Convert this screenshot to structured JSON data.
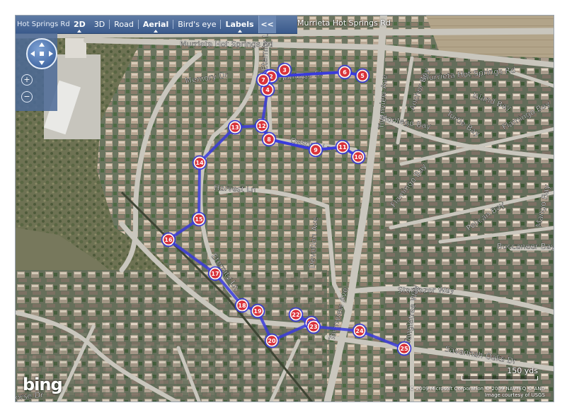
{
  "toolbar": {
    "search_text": "Hot Springs Rd",
    "items": [
      {
        "label": "2D",
        "bold": true,
        "selected": true
      },
      {
        "label": "3D",
        "bold": false,
        "selected": false
      },
      {
        "label": "Road",
        "bold": false,
        "selected": false
      },
      {
        "label": "Aerial",
        "bold": true,
        "selected": true
      },
      {
        "label": "Bird's eye",
        "bold": false,
        "selected": false
      },
      {
        "label": "Labels",
        "bold": true,
        "selected": true
      }
    ],
    "collapse_label": "<<",
    "overflow_text": "Murrieta Hot Springs Rd"
  },
  "controls": {
    "pan_icon": "compass-pan-icon",
    "zoom_in": "+",
    "zoom_out": "−"
  },
  "streets": [
    {
      "id": "murrieta-top-left",
      "text": "Murrieta Hot Springs Rd"
    },
    {
      "id": "murrieta-right",
      "text": "Murrieta Hot Springs Rd"
    },
    {
      "id": "memory",
      "text": "Memory Dr"
    },
    {
      "id": "eternity-top",
      "text": "Eternity Ln"
    },
    {
      "id": "heritage",
      "text": "Heritage St"
    },
    {
      "id": "townview-top",
      "text": "Townview Ave"
    },
    {
      "id": "anchor",
      "text": "Anchor Bay"
    },
    {
      "id": "island",
      "text": "Island Bay"
    },
    {
      "id": "turtle",
      "text": "Turtle Bay"
    },
    {
      "id": "flamingo-right",
      "text": "Flamingo Bay"
    },
    {
      "id": "montego",
      "text": "Montego Bay"
    },
    {
      "id": "destiny",
      "text": "Destiny Ln"
    },
    {
      "id": "harvest",
      "text": "Harvest Ln"
    },
    {
      "id": "devotion",
      "text": "Devotion Ave"
    },
    {
      "id": "flamingo-mid",
      "text": "Flamingo Bay"
    },
    {
      "id": "pelican",
      "text": "Pelican Bay"
    },
    {
      "id": "mango",
      "text": "Mango Bay"
    },
    {
      "id": "buccaneer",
      "text": "Buccaneer Bay"
    },
    {
      "id": "eternity-mid",
      "text": "Eternity Ln"
    },
    {
      "id": "townview-bottom",
      "text": "Townview Ave"
    },
    {
      "id": "stargazer",
      "text": "Stargazer Way"
    },
    {
      "id": "tangletree",
      "text": "Tangletree Way"
    },
    {
      "id": "savannah",
      "text": "Savannah Oaks Dr"
    },
    {
      "id": "horse",
      "text": "orse Dr"
    }
  ],
  "route": {
    "color": "#3a3bdc",
    "marker_fill": "#d9323a",
    "markers": [
      "1",
      "2",
      "3",
      "4",
      "5",
      "6",
      "7",
      "8",
      "9",
      "10",
      "11",
      "12",
      "13",
      "14",
      "15",
      "16",
      "17",
      "18",
      "19",
      "20",
      "21",
      "22",
      "23",
      "24",
      "25"
    ]
  },
  "scale": {
    "label": "150 yds"
  },
  "copyright": {
    "line1": "© 2009 Microsoft Corporation  © 2009 NAVTEQ  © AND",
    "line2": "Image courtesy of USGS"
  },
  "brand": {
    "logo_text": "bing"
  }
}
